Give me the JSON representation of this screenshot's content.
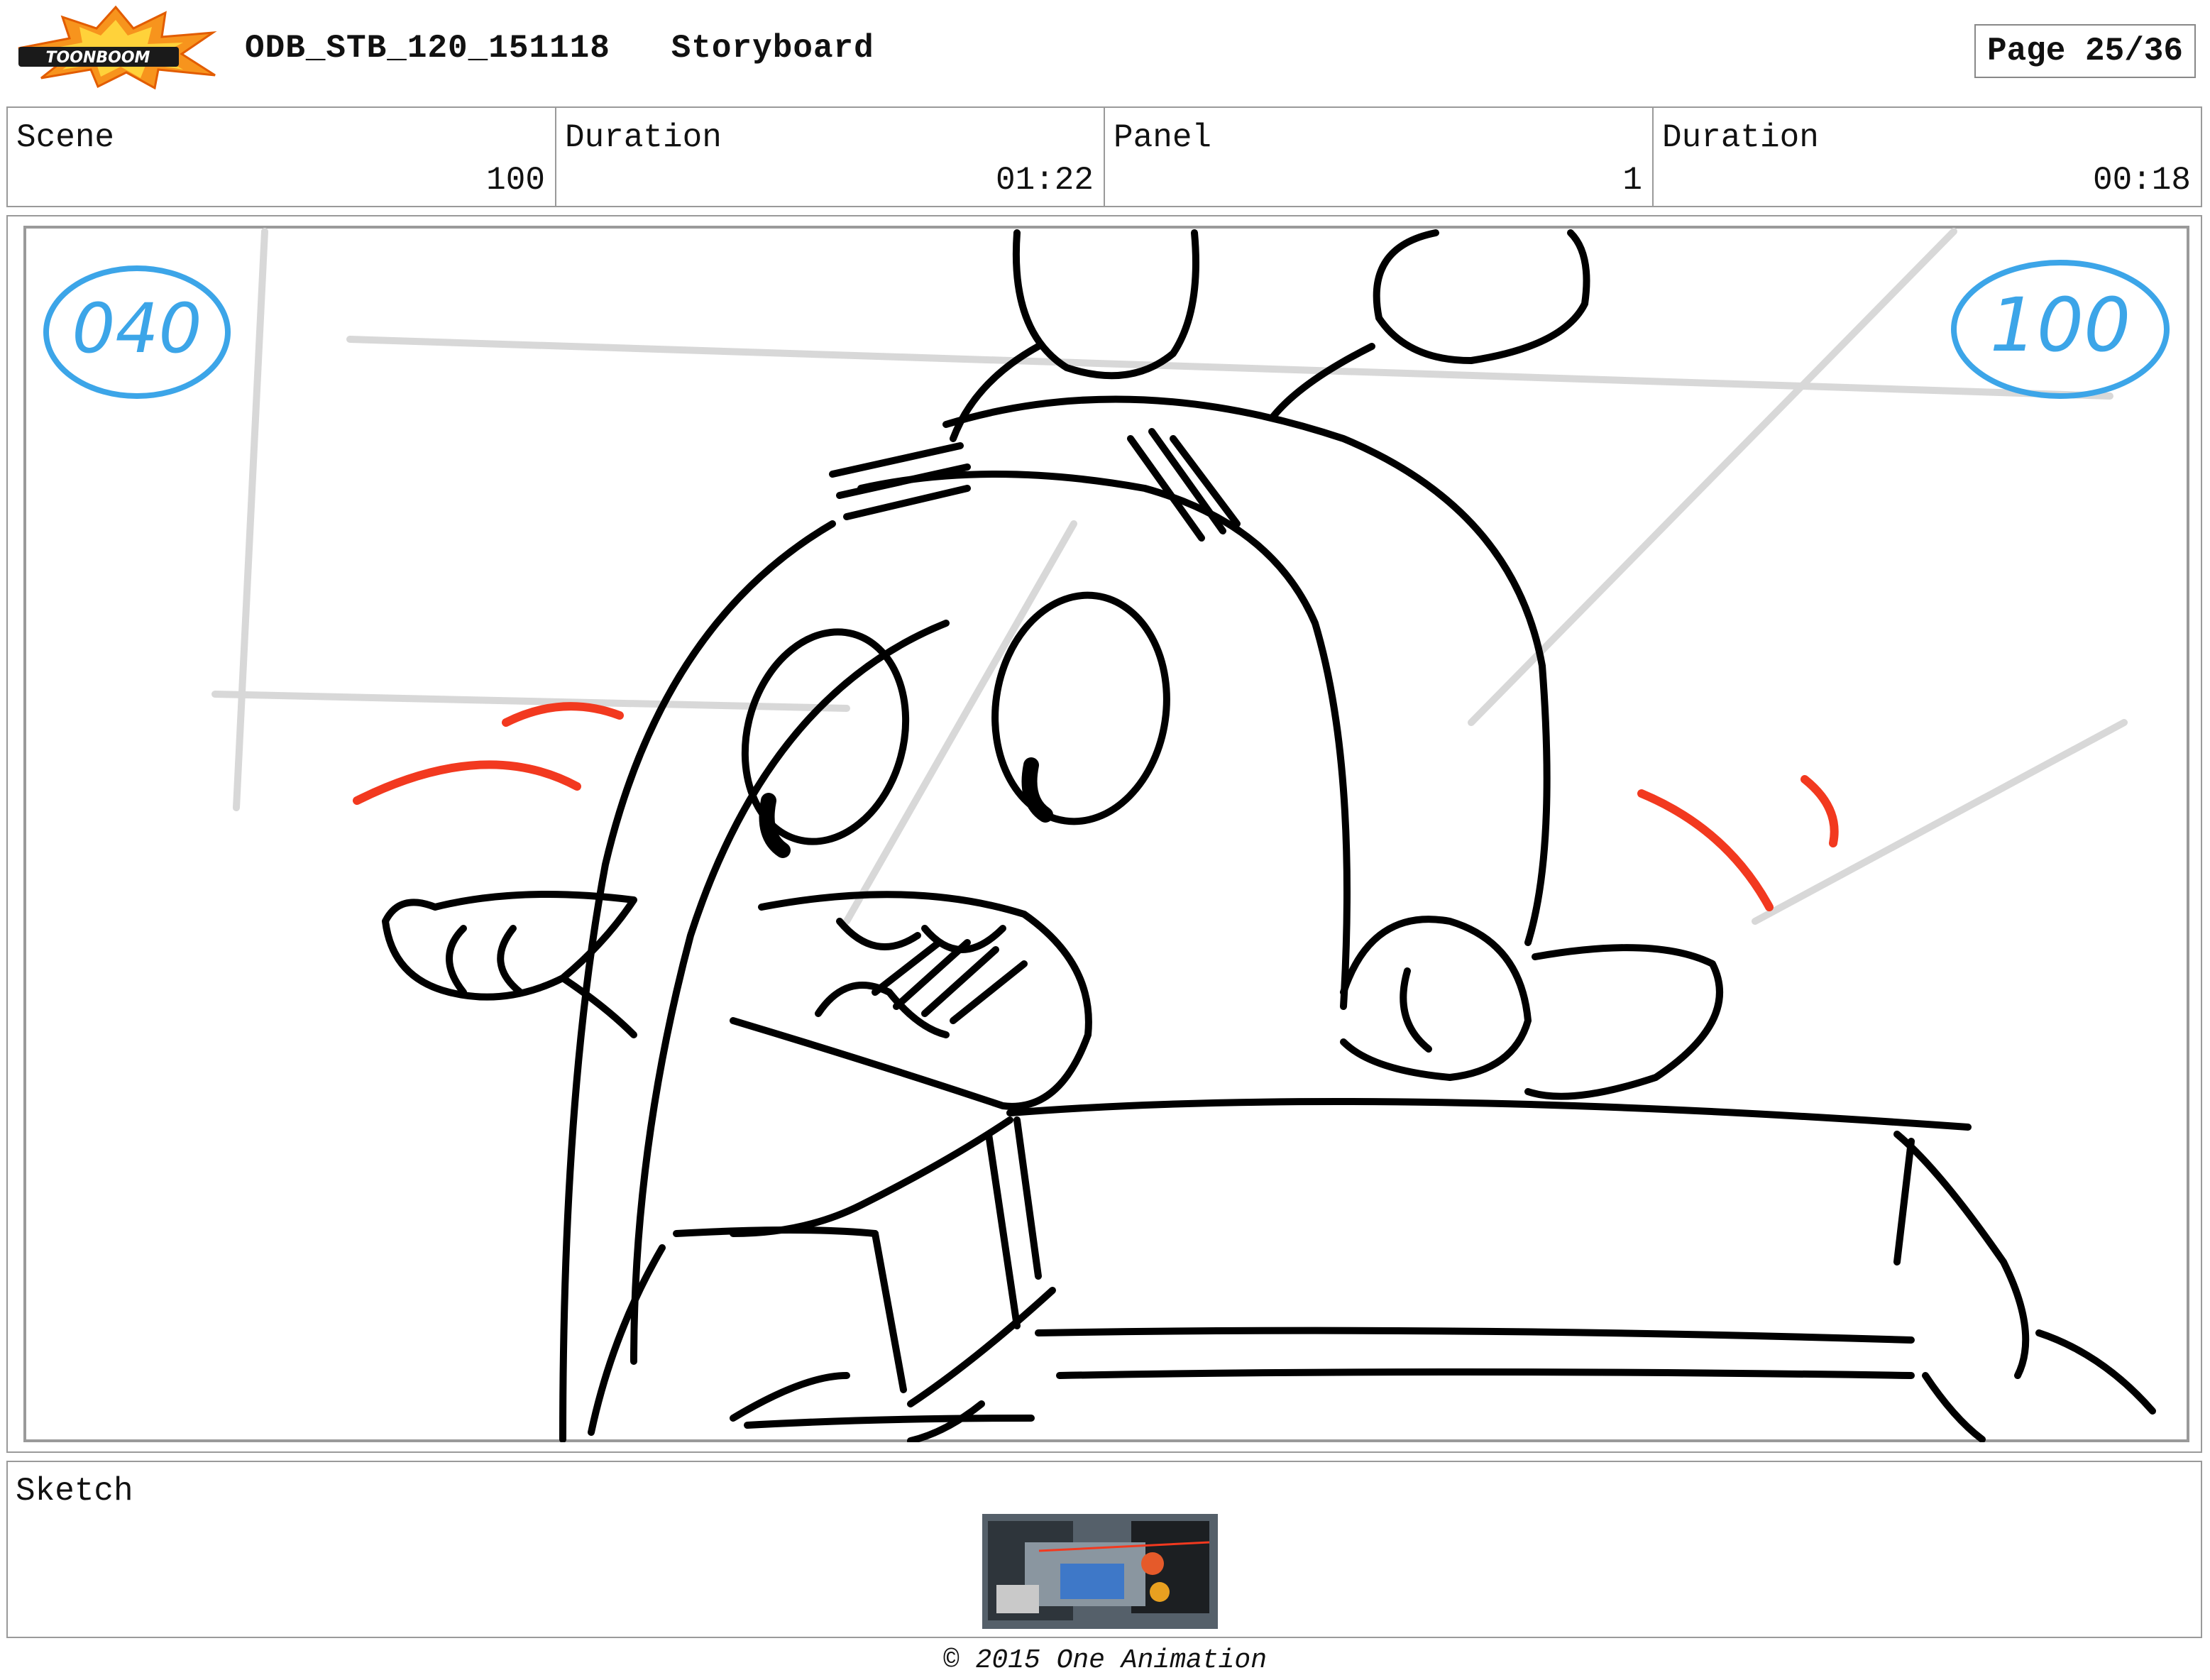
{
  "header": {
    "logo_text": "TOONBOOM",
    "project": "ODB_STB_120_151118",
    "doc_type": "Storyboard",
    "page": "Page 25/36"
  },
  "info": {
    "scene_label": "Scene",
    "scene_value": "100",
    "scene_duration_label": "Duration",
    "scene_duration_value": "01:22",
    "panel_label": "Panel",
    "panel_value": "1",
    "panel_duration_label": "Duration",
    "panel_duration_value": "00:18"
  },
  "panel": {
    "left_marker": "040",
    "right_marker": "100",
    "marker_color": "#3ca5e8",
    "motion_line_color": "#f2391f",
    "guide_color": "#d8d8d8",
    "ink_color": "#000000",
    "description": ""
  },
  "sketch": {
    "label": "Sketch"
  },
  "footer": {
    "copyright": "© 2015 One Animation"
  }
}
